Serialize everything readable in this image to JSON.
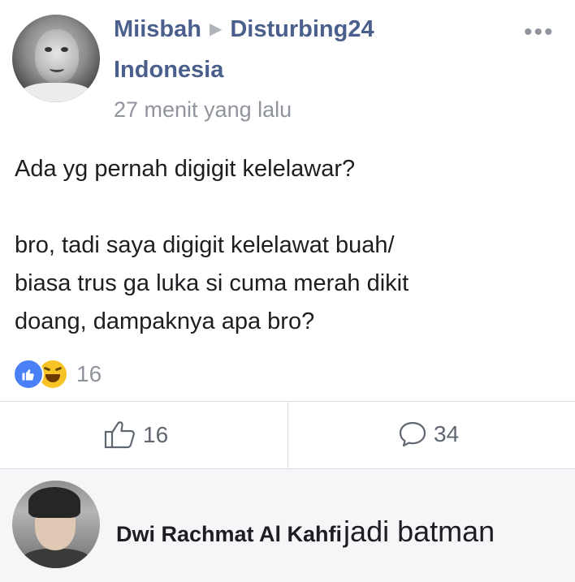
{
  "post": {
    "author": "Miisbah",
    "arrow_icon": "right-triangle-arrow-icon",
    "group_line1": "Disturbing24",
    "group_line2": "Indonesia",
    "timestamp": "27 menit yang lalu",
    "more_icon": "more-dots-icon",
    "body": {
      "line1": "Ada yg pernah digigit kelelawar?",
      "line2": "bro, tadi saya digigit kelelawat buah/",
      "line3": "biasa trus ga luka si cuma merah dikit",
      "line4": "doang, dampaknya apa bro?"
    },
    "reactions": {
      "icons": [
        "like-reaction-icon",
        "haha-reaction-icon"
      ],
      "count": "16"
    },
    "actions": {
      "like_count": "16",
      "comment_count": "34"
    }
  },
  "comment": {
    "author": "Dwi Rachmat Al Kahfi",
    "text": "jadi batman"
  },
  "colors": {
    "link": "#4b5f8c",
    "muted": "#90949c",
    "like_blue": "#4a80f5",
    "haha_yellow": "#f7c325",
    "comment_bg": "#f5f6f7"
  }
}
